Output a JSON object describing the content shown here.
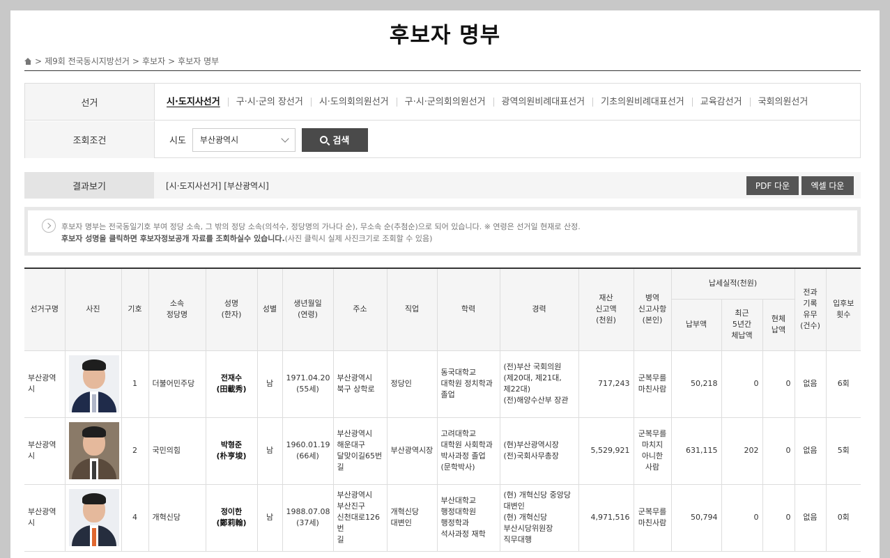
{
  "page_title": "후보자 명부",
  "breadcrumb": {
    "sep": ">",
    "items": [
      "제9회 전국동시지방선거",
      "후보자",
      "후보자 명부"
    ]
  },
  "filter": {
    "election_label": "선거",
    "tabs": [
      "시·도지사선거",
      "구·시·군의 장선거",
      "시·도의회의원선거",
      "구·시·군의회의원선거",
      "광역의원비례대표선거",
      "기초의원비례대표선거",
      "교육감선거",
      "국회의원선거"
    ],
    "active_tab": "시·도지사선거",
    "condition_label": "조회조건",
    "sido_label": "시도",
    "sido_value": "부산광역시",
    "search_label": "검색"
  },
  "result": {
    "label": "결과보기",
    "text": "[시·도지사선거] [부산광역시]",
    "pdf_label": "PDF 다운",
    "excel_label": "엑셀 다운"
  },
  "notice": {
    "line1": "후보자 명부는 전국동일기호 부여 정당 소속, 그 밖의 정당 소속(의석수, 정당명의 가나다 순), 무소속 순(추첨순)으로 되어 있습니다. ※ 연령은 선거일 현재로 산정.",
    "line2_bold": "후보자 성명을 클릭하면 후보자정보공개 자료를 조회하실수 있습니다.",
    "line2_rest": "(사진 클릭시 실제 사진크기로 조회할 수 있음)"
  },
  "table": {
    "headers": {
      "district": "선거구명",
      "photo": "사진",
      "number": "기호",
      "party": "소속\n정당명",
      "name": "성명\n(한자)",
      "gender": "성별",
      "birth": "생년월일\n(연령)",
      "address": "주소",
      "job": "직업",
      "education": "학력",
      "career": "경력",
      "assets": "재산\n신고액\n(천원)",
      "military": "병역\n신고사항\n(본인)",
      "tax_group": "납세실적(천원)",
      "tax_paid": "납부액",
      "tax_5y": "최근\n5년간\n체납액",
      "tax_now": "현체\n납액",
      "criminal": "전과\n기록\n유무\n(건수)",
      "runs": "입후보\n횟수"
    },
    "rows": [
      {
        "district": "부산광역시",
        "photo": "candidate-photo",
        "number": "1",
        "party": "더불어민주당",
        "name": "전재수\n(田載秀)",
        "gender": "남",
        "birth": "1971.04.20\n(55세)",
        "address": "부산광역시\n북구 상학로",
        "job": "정당인",
        "education": "동국대학교\n대학원 정치학과\n졸업",
        "career": "(전)부산 국회의원\n(제20대, 제21대,\n제22대)\n(전)해양수산부 장관",
        "assets": "717,243",
        "military": "군복무를\n마친사람",
        "tax_paid": "50,218",
        "tax_5y": "0",
        "tax_now": "0",
        "criminal": "없음",
        "runs": "6회"
      },
      {
        "district": "부산광역시",
        "photo": "candidate-photo",
        "number": "2",
        "party": "국민의힘",
        "name": "박형준\n(朴亨埈)",
        "gender": "남",
        "birth": "1960.01.19\n(66세)",
        "address": "부산광역시\n해운대구\n달맞이길65번\n길",
        "job": "부산광역시장",
        "education": "고려대학교\n대학원 사회학과\n박사과정 졸업\n(문학박사)",
        "career": "(현)부산광역시장\n(전)국회사무총장",
        "assets": "5,529,921",
        "military": "군복무를\n마치지\n아니한\n사람",
        "tax_paid": "631,115",
        "tax_5y": "202",
        "tax_now": "0",
        "criminal": "없음",
        "runs": "5회"
      },
      {
        "district": "부산광역시",
        "photo": "candidate-photo",
        "number": "4",
        "party": "개혁신당",
        "name": "정이한\n(鄭莉翰)",
        "gender": "남",
        "birth": "1988.07.08\n(37세)",
        "address": "부산광역시\n부산진구\n신천대로126번\n길",
        "job": "개혁신당\n대변인",
        "education": "부산대학교\n행정대학원\n행정학과\n석사과정 재학",
        "career": "(현) 개혁신당 중앙당\n대변인\n(현) 개혁신당\n부산시당위원장\n직무대행",
        "assets": "4,971,516",
        "military": "군복무를\n마친사람",
        "tax_paid": "50,794",
        "tax_5y": "0",
        "tax_now": "0",
        "criminal": "없음",
        "runs": "0회"
      }
    ]
  },
  "photo_styles": [
    {
      "suit": "#1f2b4a",
      "tie": "#b0b6c8",
      "bg": "#eef0f3"
    },
    {
      "suit": "#5a4a3c",
      "tie": "#3b3b3b",
      "bg": "#8a7a68"
    },
    {
      "suit": "#252d3e",
      "tie": "#e0672f",
      "bg": "#eceef2"
    }
  ]
}
